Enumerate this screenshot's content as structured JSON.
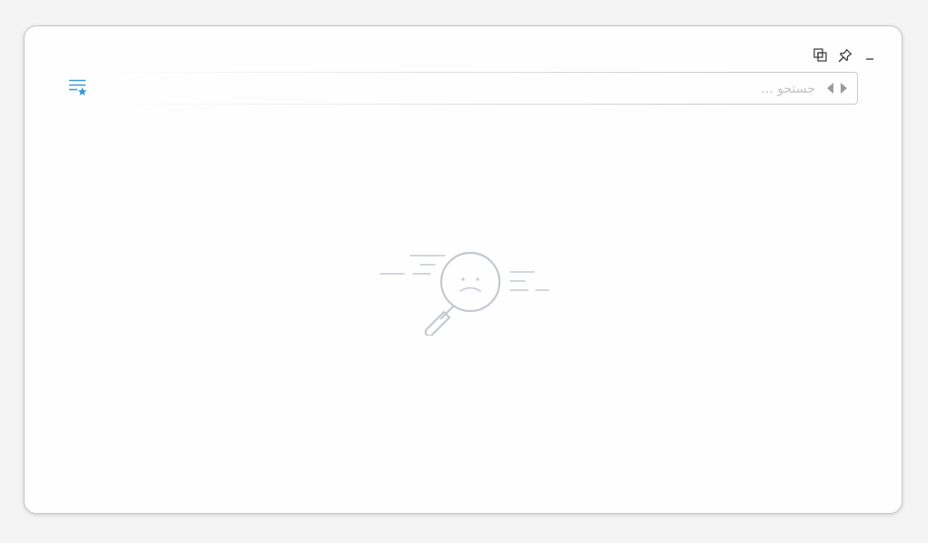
{
  "search": {
    "placeholder": "جستجو ...",
    "value": ""
  },
  "icons": {
    "favorites": "list-star-icon",
    "search_next": "arrow-right-icon",
    "search_prev": "arrow-left-icon",
    "restore": "restore-windows-icon",
    "pin": "pin-icon",
    "minimize": "minimize-icon",
    "empty": "sad-magnifier-icon"
  },
  "colors": {
    "accent": "#3d9ad6",
    "icon_dark": "#333333",
    "empty_illustration": "#c4c8d0",
    "border": "#c9c9c9"
  }
}
